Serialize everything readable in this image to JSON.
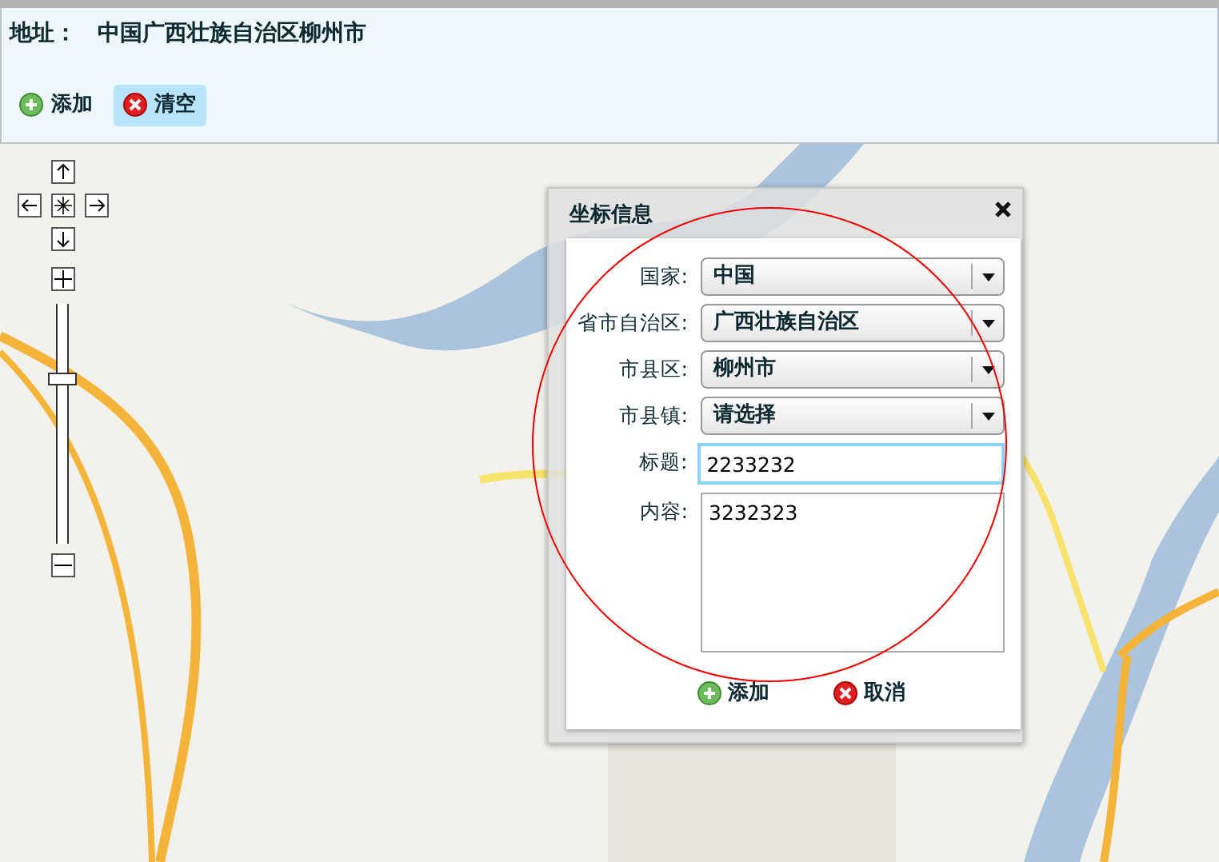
{
  "header": {
    "address_label": "地址：",
    "address_value": "中国广西壮族自治区柳州市",
    "buttons": [
      {
        "kind": "add",
        "label": "添加",
        "hovered": false
      },
      {
        "kind": "clear",
        "label": "清空",
        "hovered": true
      }
    ]
  },
  "map": {
    "zoom_slider": {
      "level": 0.69
    }
  },
  "dialog": {
    "title": "坐标信息",
    "fields": [
      {
        "kind": "select",
        "label": "国家:",
        "value": "中国",
        "focused": false
      },
      {
        "kind": "select",
        "label": "省市自治区:",
        "value": "广西壮族自治区",
        "focused": false
      },
      {
        "kind": "select",
        "label": "市县区:",
        "value": "柳州市",
        "focused": false
      },
      {
        "kind": "select",
        "label": "市县镇:",
        "value": "请选择",
        "focused": false
      },
      {
        "kind": "text",
        "label": "标题:",
        "value": "2233232",
        "focused": true
      },
      {
        "kind": "textarea",
        "label": "内容:",
        "value": "3232323",
        "focused": false
      }
    ],
    "buttons": [
      {
        "kind": "add",
        "label": "添加"
      },
      {
        "kind": "cancel",
        "label": "取消"
      }
    ]
  }
}
